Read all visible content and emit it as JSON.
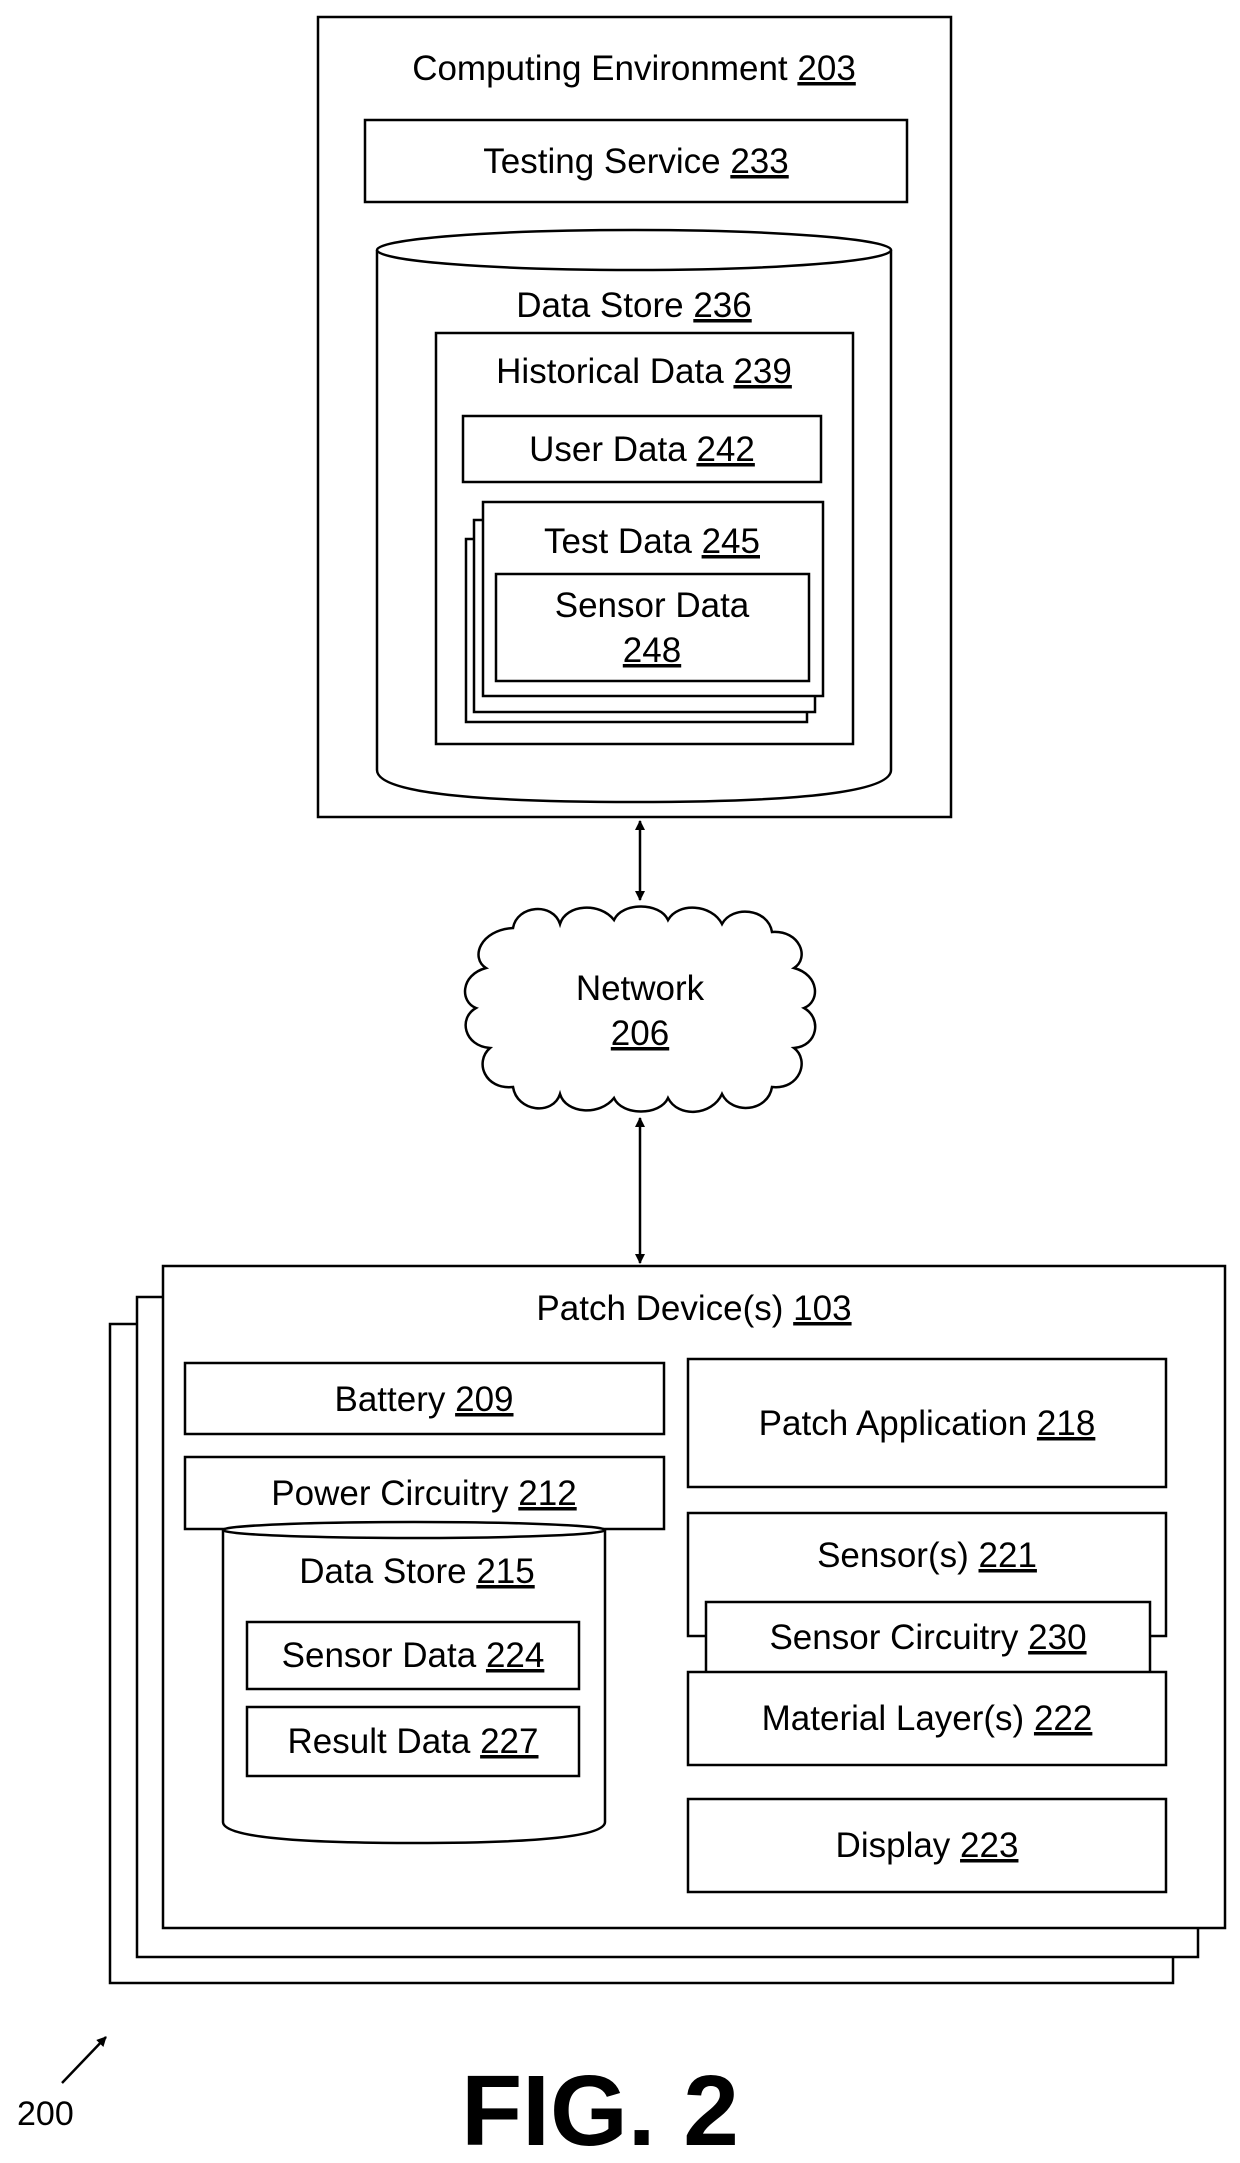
{
  "figure": {
    "label": "FIG. 2",
    "reference": "200"
  },
  "computing_environment": {
    "name": "Computing Environment",
    "ref": "203",
    "testing_service": {
      "name": "Testing Service",
      "ref": "233"
    },
    "data_store": {
      "name": "Data Store",
      "ref": "236",
      "historical_data": {
        "name": "Historical Data",
        "ref": "239",
        "user_data": {
          "name": "User Data",
          "ref": "242"
        },
        "test_data": {
          "name": "Test Data",
          "ref": "245",
          "sensor_data": {
            "name": "Sensor Data",
            "ref": "248"
          }
        }
      }
    }
  },
  "network": {
    "name": "Network",
    "ref": "206"
  },
  "patch_devices": {
    "name": "Patch Device(s)",
    "ref": "103",
    "battery": {
      "name": "Battery",
      "ref": "209"
    },
    "power_circuitry": {
      "name": "Power Circuitry",
      "ref": "212"
    },
    "data_store": {
      "name": "Data Store",
      "ref": "215",
      "sensor_data": {
        "name": "Sensor Data",
        "ref": "224"
      },
      "result_data": {
        "name": "Result Data",
        "ref": "227"
      }
    },
    "patch_application": {
      "name": "Patch Application",
      "ref": "218"
    },
    "sensors": {
      "name": "Sensor(s)",
      "ref": "221",
      "sensor_circuitry": {
        "name": "Sensor Circuitry",
        "ref": "230"
      }
    },
    "material_layers": {
      "name": "Material Layer(s)",
      "ref": "222"
    },
    "display": {
      "name": "Display",
      "ref": "223"
    }
  }
}
